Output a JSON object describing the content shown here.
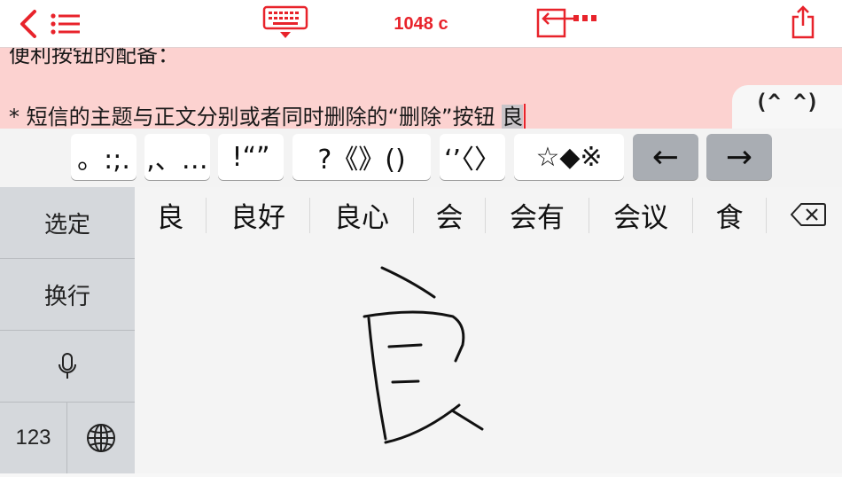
{
  "toolbar": {
    "back_icon": "chevron-left-icon",
    "menu_icon": "list-icon",
    "keyboard_icon": "keyboard-hide-icon",
    "char_count": "1048 c",
    "move_icon": "move-cursor-icon",
    "share_icon": "share-icon",
    "accent_color": "#e8232b"
  },
  "editor": {
    "line1": "便利按钮的配备：",
    "line2_prefix": "* 短信的主题与正文分别或者同时删除的“删除”按钮 ",
    "selection": "良",
    "background": "#fcd2d0"
  },
  "emoticon_tab": {
    "label": "(^ ^)"
  },
  "punct_keys": [
    {
      "label": "。:;."
    },
    {
      "label": ",、…"
    },
    {
      "label": "!“”"
    },
    {
      "label": "?《》()"
    },
    {
      "label": "‘’〈〉"
    },
    {
      "label": "☆◆※"
    },
    {
      "label": "←"
    },
    {
      "label": "→"
    }
  ],
  "side_keys": {
    "select": "选定",
    "newline": "换行",
    "mic_icon": "microphone-icon",
    "numbers": "123",
    "globe_icon": "globe-icon"
  },
  "candidates": [
    "良",
    "良好",
    "良心",
    "会",
    "会有",
    "会议",
    "食"
  ],
  "delete_icon": "backspace-icon"
}
